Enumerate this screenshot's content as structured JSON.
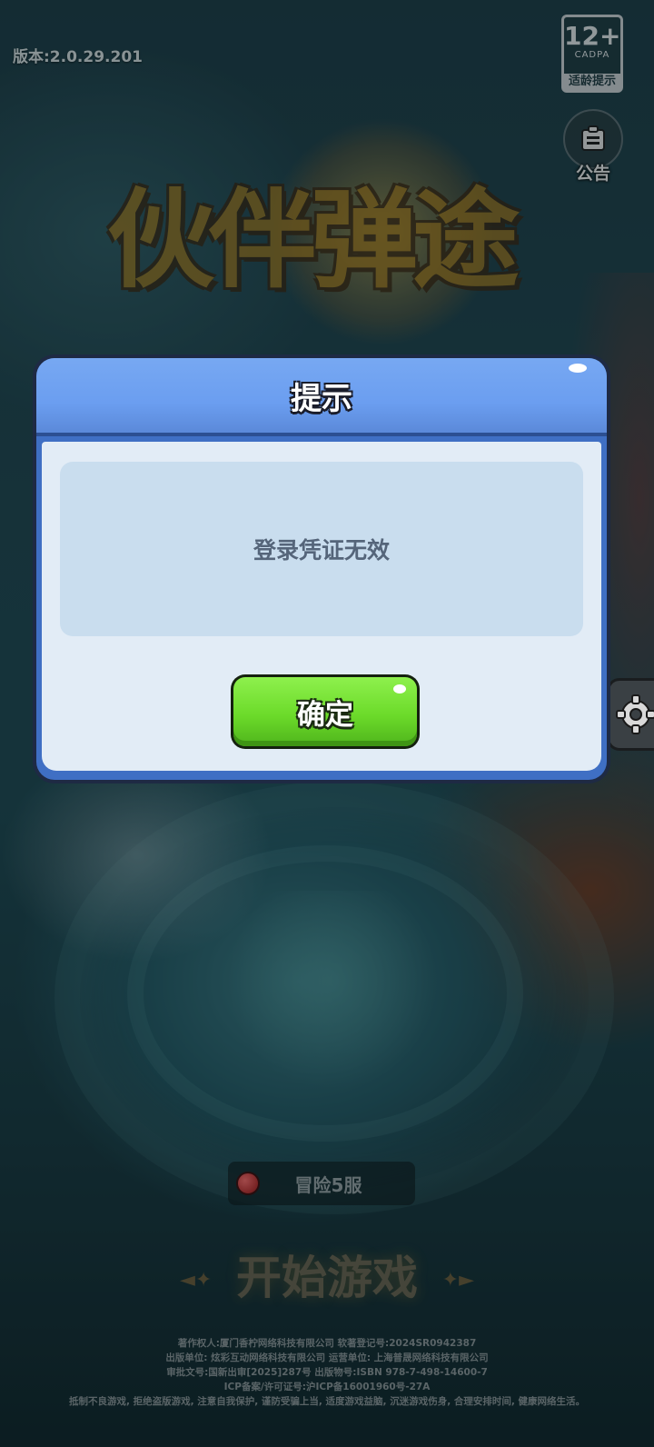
{
  "version_label": "版本:2.0.29.201",
  "age_rating": {
    "age": "12+",
    "org": "CADPA",
    "tip": "适龄提示"
  },
  "notice": {
    "label": "公告",
    "icon": "notice-board-icon"
  },
  "logo": {
    "text": "伙伴弹途"
  },
  "dialog": {
    "title": "提示",
    "message": "登录凭证无效",
    "confirm_label": "确定"
  },
  "server": {
    "label": "冒险5服",
    "status_color": "#d31f1f"
  },
  "start": {
    "label": "开始游戏"
  },
  "footer": {
    "lines": [
      "著作权人:厦门香柠网络科技有限公司    软著登记号:2024SR0942387",
      "出版单位: 炫彩互动网络科技有限公司    运营单位: 上海普晟网络科技有限公司",
      "审批文号:国新出审[2025]287号    出版物号:ISBN 978-7-498-14600-7",
      "ICP备案/许可证号:沪ICP备16001960号-27A",
      "抵制不良游戏, 拒绝盗版游戏, 注意自我保护, 谨防受骗上当, 适度游戏益脑, 沉迷游戏伤身, 合理安排时间, 健康网络生活。"
    ]
  },
  "colors": {
    "dialog_header": "#6b9ef0",
    "dialog_body": "#e2ecf6",
    "confirm_button": "#6cdb2a"
  }
}
